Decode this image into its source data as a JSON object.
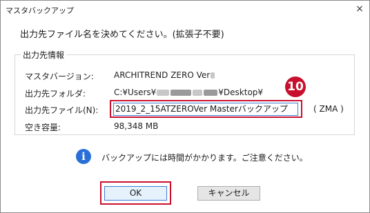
{
  "window": {
    "title": "マスタバックアップ",
    "close_glyph": "×"
  },
  "instruction": "出力先ファイル名を決めてください。(拡張子不要)",
  "group": {
    "legend": "出力先情報",
    "rows": {
      "master_version": {
        "label": "マスタバージョン:",
        "value": "ARCHITREND ZERO Ver"
      },
      "output_folder": {
        "label": "出力先フォルダ:",
        "value_prefix": "C:¥Users¥",
        "value_suffix": "¥Desktop¥"
      },
      "output_file": {
        "label": "出力先ファイル(N):",
        "value": "2019_2_15ATZEROVer Masterバックアップ",
        "extension": "( ZMA )"
      },
      "free_space": {
        "label": "空き容量:",
        "value": "98,348 MB"
      }
    }
  },
  "step_badge": "10",
  "info": {
    "icon": "info-icon",
    "message": "バックアップには時間がかかります。ご注意ください。"
  },
  "buttons": {
    "ok": "OK",
    "cancel": "キャンセル"
  },
  "colors": {
    "highlight": "#c8102e",
    "info_blue": "#2a6fd6",
    "focus_border": "#3b7dd8"
  }
}
